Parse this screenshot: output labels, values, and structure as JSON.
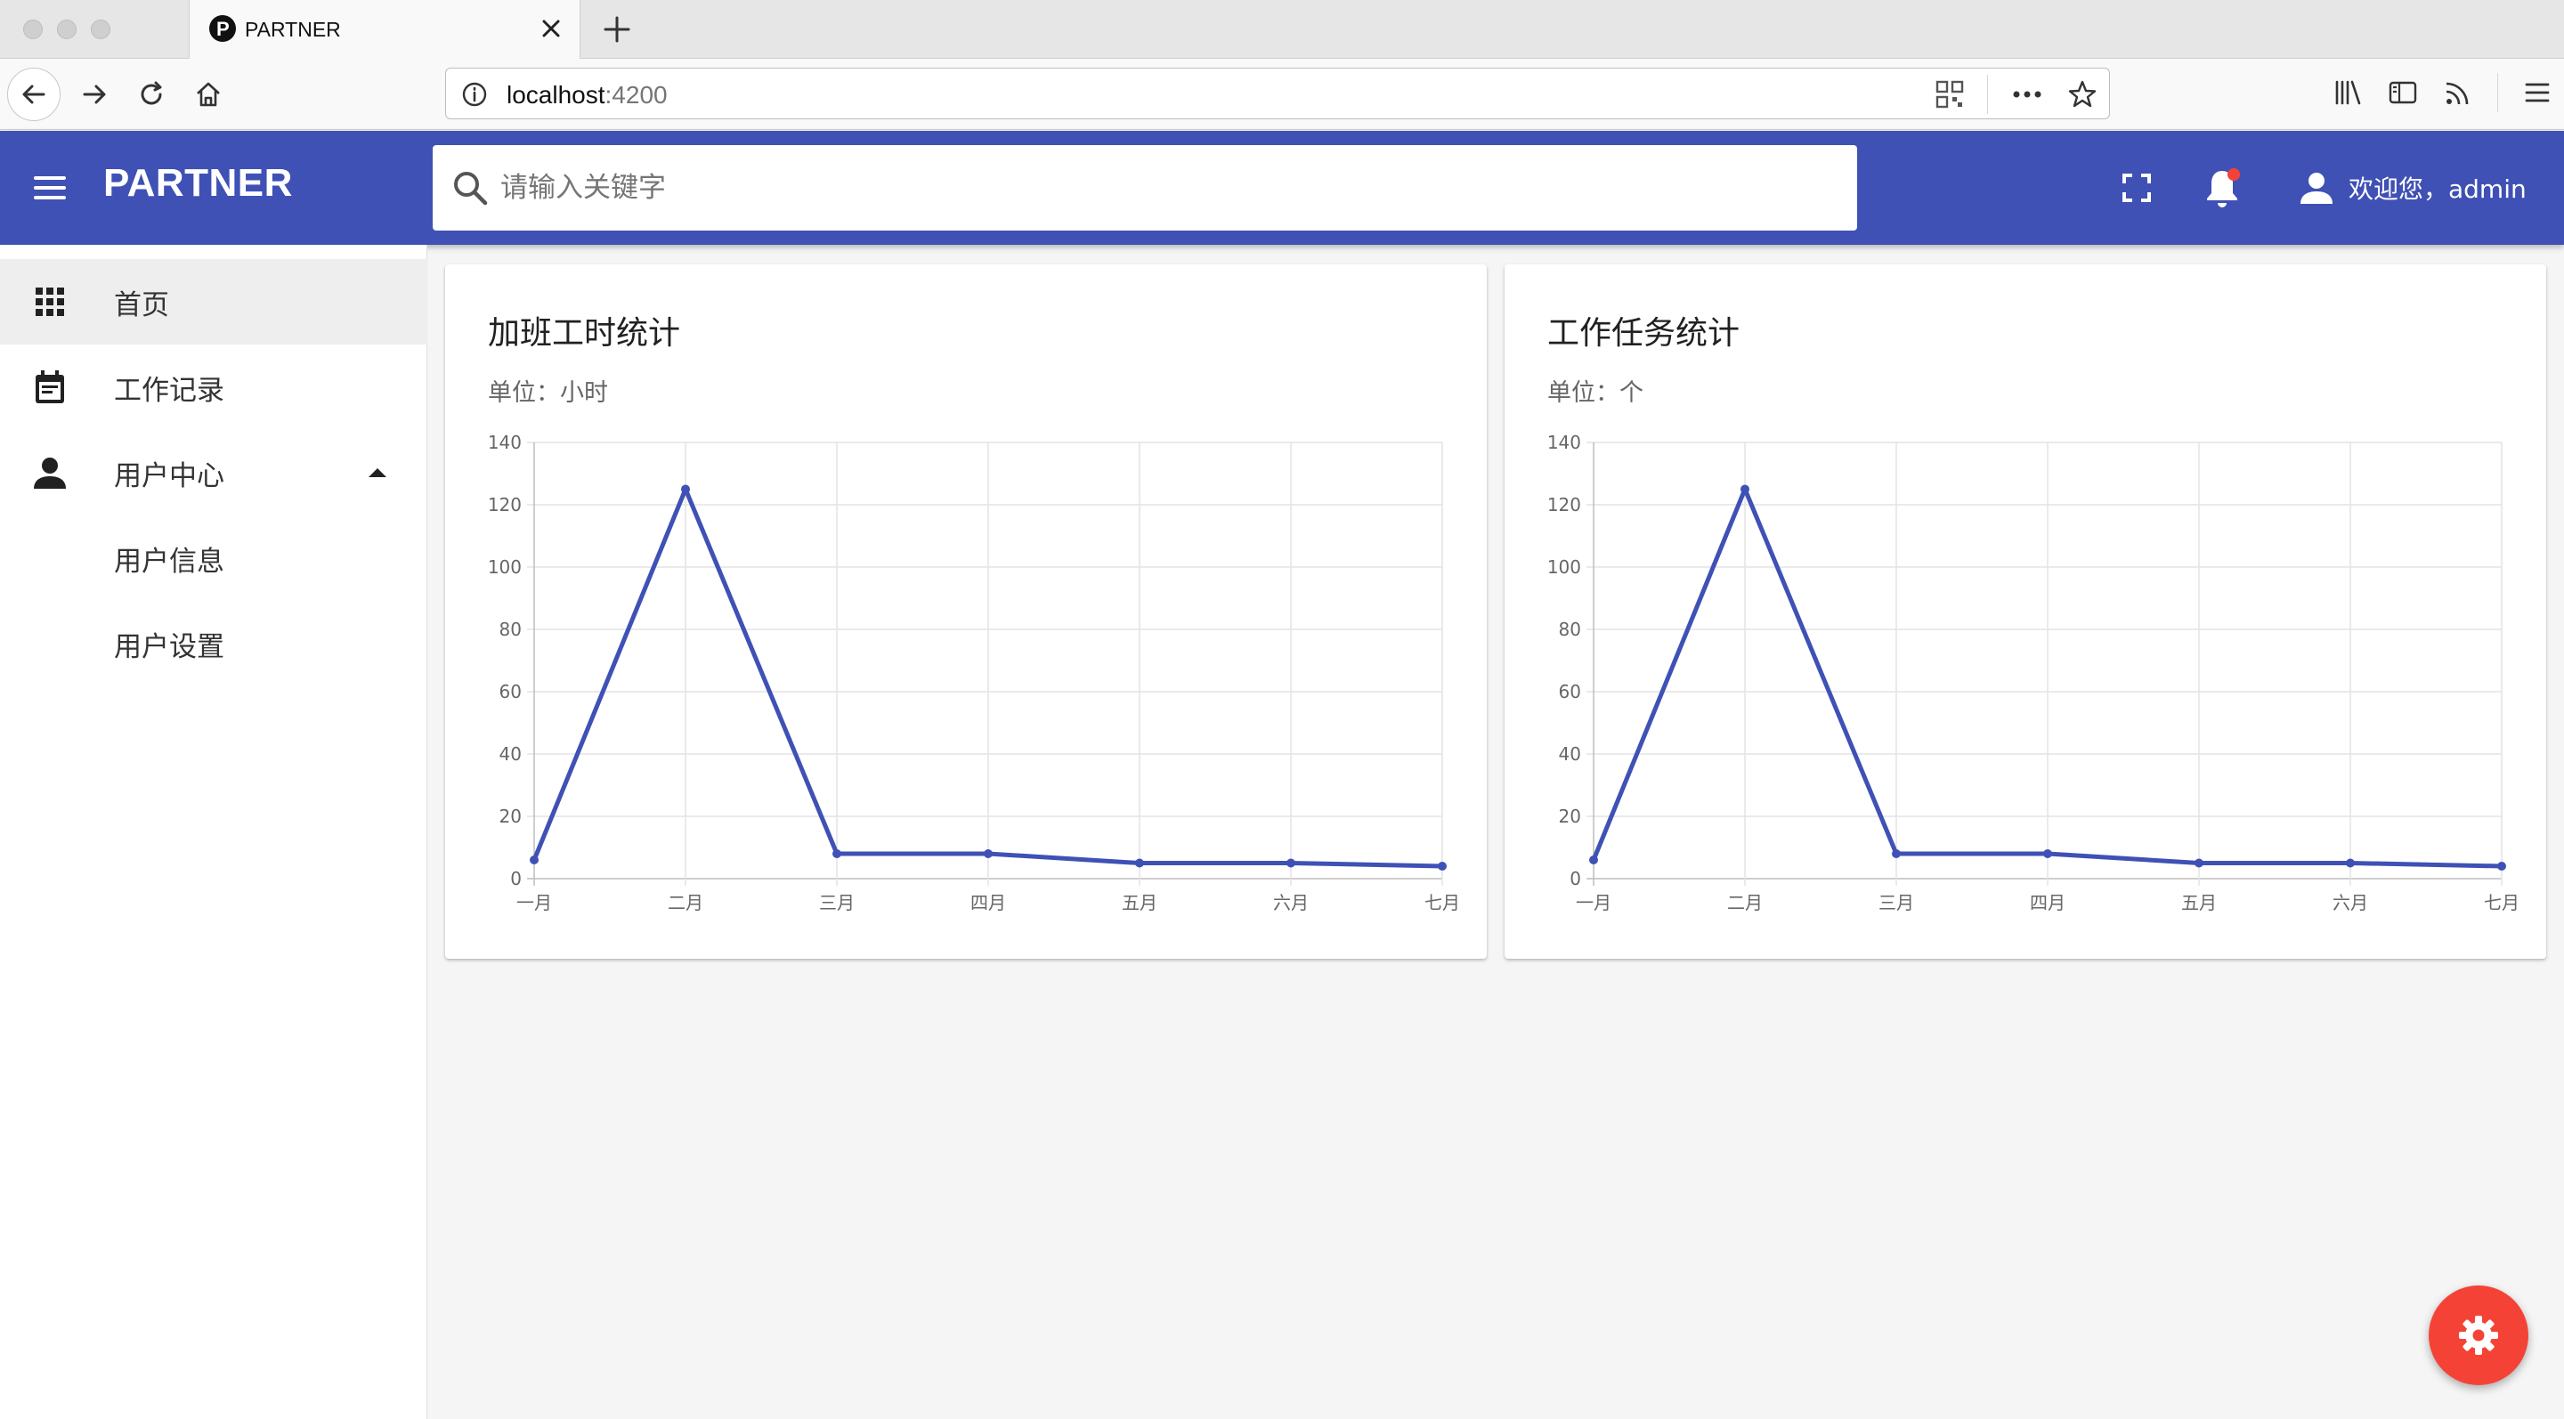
{
  "browser": {
    "tab_title": "PARTNER",
    "url_host": "localhost",
    "url_port": ":4200"
  },
  "app": {
    "brand": "PARTNER",
    "search_placeholder": "请输入关键字",
    "user_greeting": "欢迎您，admin",
    "accent_color": "#3f51b5",
    "notification_dot_color": "#f44336",
    "fab_color": "#f44336"
  },
  "sidebar": {
    "items": [
      {
        "label": "首页",
        "icon": "apps-grid-icon",
        "active": true
      },
      {
        "label": "工作记录",
        "icon": "calendar-icon"
      },
      {
        "label": "用户中心",
        "icon": "person-icon",
        "expanded": true
      },
      {
        "label": "用户信息"
      },
      {
        "label": "用户设置"
      }
    ]
  },
  "cards": [
    {
      "title": "加班工时统计",
      "subtitle": "单位：小时"
    },
    {
      "title": "工作任务统计",
      "subtitle": "单位：个"
    }
  ],
  "chart_data": [
    {
      "type": "line",
      "title": "加班工时统计",
      "x": [
        "一月",
        "二月",
        "三月",
        "四月",
        "五月",
        "六月",
        "七月"
      ],
      "values": [
        6,
        125,
        8,
        8,
        5,
        5,
        4
      ],
      "ylim": [
        0,
        140
      ],
      "yticks": [
        0,
        20,
        40,
        60,
        80,
        100,
        120,
        140
      ],
      "grid": true,
      "color": "#3f51b5"
    },
    {
      "type": "line",
      "title": "工作任务统计",
      "x": [
        "一月",
        "二月",
        "三月",
        "四月",
        "五月",
        "六月",
        "七月"
      ],
      "values": [
        6,
        125,
        8,
        8,
        5,
        5,
        4
      ],
      "ylim": [
        0,
        140
      ],
      "yticks": [
        0,
        20,
        40,
        60,
        80,
        100,
        120,
        140
      ],
      "grid": true,
      "color": "#3f51b5"
    }
  ]
}
